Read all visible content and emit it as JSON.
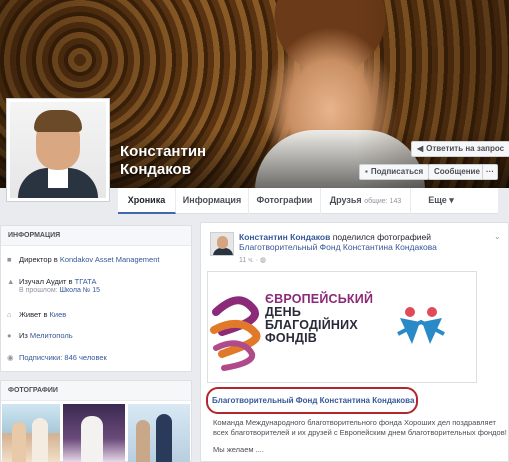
{
  "profile": {
    "name_line1": "Константин",
    "name_line2": "Кондаков"
  },
  "actions": {
    "reply_request": "Ответить на запрос",
    "subscribe": "Подписаться",
    "message": "Сообщение",
    "more": "···"
  },
  "tabs": [
    {
      "label": "Хроника",
      "active": true
    },
    {
      "label": "Информация"
    },
    {
      "label": "Фотографии"
    },
    {
      "label": "Друзья",
      "extra": "общие: 143"
    },
    {
      "label": "Еще ▾"
    }
  ],
  "info": {
    "title": "ИНФОРМАЦИЯ",
    "rows": [
      {
        "icon": "briefcase-icon",
        "text": "Директор в ",
        "link": "Kondakov Asset Management"
      },
      {
        "icon": "graduation-icon",
        "text": "Изучал Аудит в ",
        "link": "ТГАТА",
        "sub": "В прошлом: ",
        "sub_link": "Школа № 15"
      },
      {
        "icon": "home-icon",
        "text": "Живет в ",
        "link": "Киев"
      },
      {
        "icon": "location-icon",
        "text": "Из ",
        "link": "Мелитополь"
      },
      {
        "icon": "rss-icon",
        "text": "Подписчики: 846 человек"
      }
    ]
  },
  "photos": {
    "title": "ФОТОГРАФИИ"
  },
  "post": {
    "author": "Константин Кондаков",
    "action": " поделился фотографией",
    "target": "Благотворительный Фонд Константина Кондакова",
    "time": "11 ч. ·",
    "logo_lines": [
      "ЄВРОПЕЙСЬКИЙ",
      "ДЕНЬ",
      "БЛАГОДІЙНИХ",
      "ФОНДІВ"
    ],
    "link_title": "Благотворительный Фонд Константина Кондакова",
    "description": "Команда Международного благотворительного фонда Хороших дел поздравляет всех благотворителей и их друзей с Европейским днем благотворительных фондов!",
    "description2": "Мы желаем ...."
  }
}
